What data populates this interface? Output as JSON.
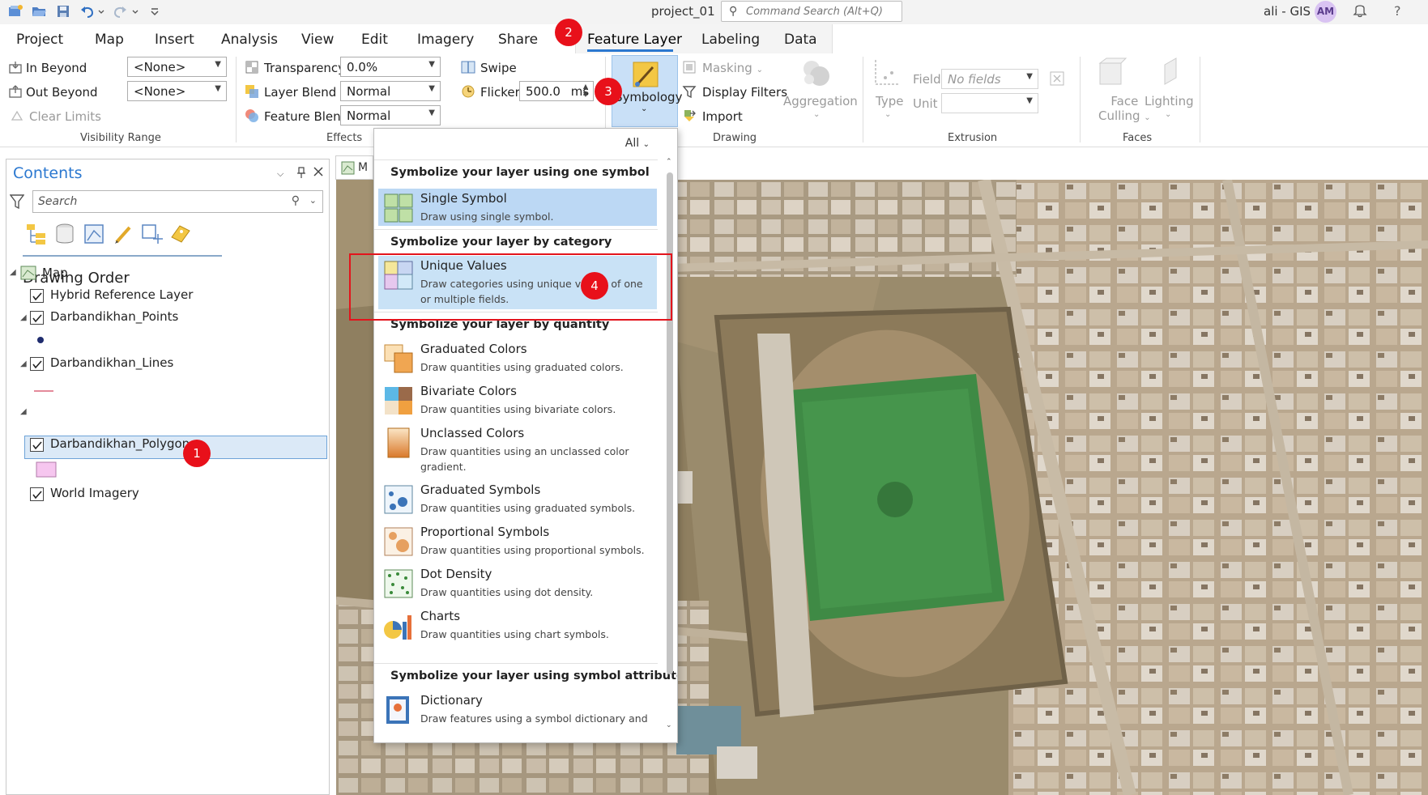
{
  "titlebar": {
    "project": "project_01",
    "command_search_placeholder": "Command Search (Alt+Q)",
    "user": "ali - GIS",
    "avatar_initials": "AM",
    "help": "?"
  },
  "tabs": [
    "Project",
    "Map",
    "Insert",
    "Analysis",
    "View",
    "Edit",
    "Imagery",
    "Share",
    "Feature Layer",
    "Labeling",
    "Data"
  ],
  "active_tab": "Feature Layer",
  "ribbon": {
    "visibility_range": {
      "in_beyond": "In Beyond",
      "out_beyond": "Out Beyond",
      "clear_limits": "Clear Limits",
      "in_value": "<None>",
      "out_value": "<None>",
      "label": "Visibility Range"
    },
    "effects": {
      "transparency": "Transparency",
      "transparency_value": "0.0%",
      "layer_blend": "Layer Blend",
      "layer_blend_value": "Normal",
      "feature_blend": "Feature Blend",
      "feature_blend_value": "Normal",
      "swipe": "Swipe",
      "flicker": "Flicker",
      "flicker_value": "500.0",
      "flicker_unit": "ms",
      "label": "Effects"
    },
    "drawing": {
      "symbology": "Symbology",
      "masking": "Masking",
      "display_filters": "Display Filters",
      "import": "Import",
      "aggregation": "Aggregation",
      "label": "Drawing"
    },
    "extrusion": {
      "type": "Type",
      "field": "Field",
      "field_value": "No fields",
      "unit": "Unit",
      "label": "Extrusion"
    },
    "faces": {
      "face": "Face",
      "culling": "Culling",
      "lighting": "Lighting",
      "label": "Faces"
    }
  },
  "contents": {
    "title": "Contents",
    "search_placeholder": "Search",
    "drawing_order": "Drawing Order",
    "layers": {
      "map": "Map",
      "hybrid": "Hybrid Reference Layer",
      "points": "Darbandikhan_Points",
      "lines": "Darbandikhan_Lines",
      "polygons": "Darbandikhan_Polygons",
      "imagery": "World Imagery"
    }
  },
  "map_tab": "M",
  "dropdown": {
    "filter": "All",
    "sections": [
      {
        "heading": "Symbolize your layer using one symbol"
      },
      {
        "heading": "Symbolize your layer by category"
      },
      {
        "heading": "Symbolize your layer by quantity"
      },
      {
        "heading": "Symbolize your layer using symbol attributes"
      }
    ],
    "items": [
      {
        "title": "Single Symbol",
        "desc": "Draw using single symbol."
      },
      {
        "title": "Unique Values",
        "desc": "Draw categories using unique values of one or multiple fields."
      },
      {
        "title": "Graduated Colors",
        "desc": "Draw quantities using graduated colors."
      },
      {
        "title": "Bivariate Colors",
        "desc": "Draw quantities using bivariate colors."
      },
      {
        "title": "Unclassed Colors",
        "desc": "Draw quantities using an unclassed color gradient."
      },
      {
        "title": "Graduated Symbols",
        "desc": "Draw quantities using graduated symbols."
      },
      {
        "title": "Proportional Symbols",
        "desc": "Draw quantities using proportional symbols."
      },
      {
        "title": "Dot Density",
        "desc": "Draw quantities using dot density."
      },
      {
        "title": "Charts",
        "desc": "Draw quantities using chart symbols."
      },
      {
        "title": "Dictionary",
        "desc": "Draw features using a symbol dictionary and"
      }
    ]
  },
  "markers": [
    "1",
    "2",
    "3",
    "4"
  ]
}
